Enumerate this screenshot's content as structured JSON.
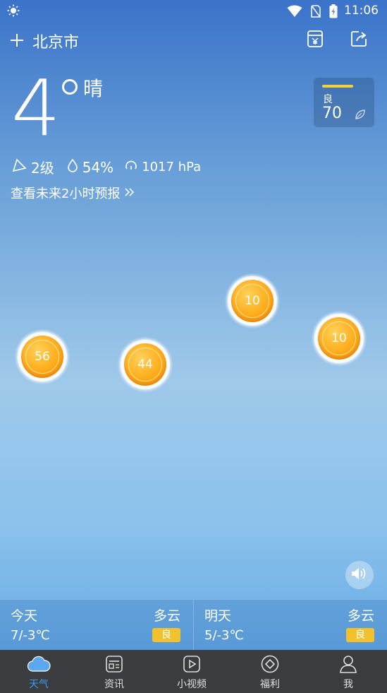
{
  "status_bar": {
    "time": "11:06"
  },
  "header": {
    "city": "北京市"
  },
  "current": {
    "temperature": "4",
    "condition": "晴",
    "wind": "2级",
    "humidity": "54%",
    "pressure": "1017 hPa",
    "forecast_link": "查看未来2小时预报"
  },
  "aqi": {
    "level": "良",
    "value": "70",
    "accent": "#f4d13c"
  },
  "bubbles": [
    "56",
    "44",
    "10",
    "10"
  ],
  "days": [
    {
      "name": "今天",
      "weather": "多云",
      "range": "7/-3℃",
      "aqi": "良"
    },
    {
      "name": "明天",
      "weather": "多云",
      "range": "5/-3℃",
      "aqi": "良"
    }
  ],
  "tabs": [
    {
      "label": "天气",
      "icon": "cloud-icon",
      "active": true
    },
    {
      "label": "资讯",
      "icon": "news-icon"
    },
    {
      "label": "小视频",
      "icon": "play-icon"
    },
    {
      "label": "福利",
      "icon": "diamond-icon"
    },
    {
      "label": "我",
      "icon": "person-icon"
    }
  ],
  "colors": {
    "active_tab": "#3d9df2",
    "badge": "#f2c12e",
    "bubble": "#ffac1a"
  }
}
